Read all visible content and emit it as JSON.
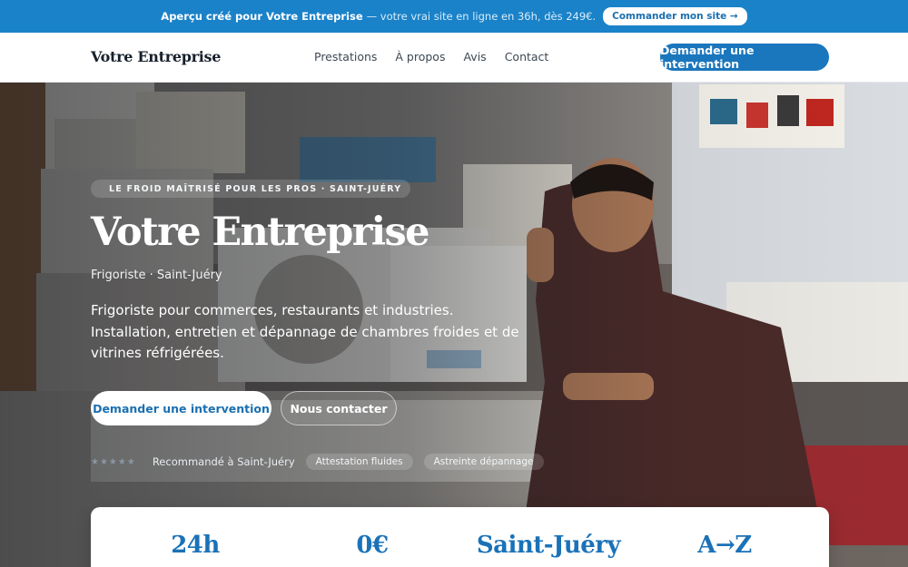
{
  "promo": {
    "lead": "Aperçu créé pour Votre Entreprise",
    "rest": "— votre vrai site en ligne en 36h, dès 249€.",
    "cta": "Commander mon site →"
  },
  "nav": {
    "brand": "Votre Entreprise",
    "items": [
      "Prestations",
      "À propos",
      "Avis",
      "Contact"
    ],
    "cta": "Demander une intervention"
  },
  "hero": {
    "eyebrow": "LE FROID MAÎTRISÉ POUR LES PROS · SAINT-JUÉRY",
    "title": "Votre Entreprise",
    "subtitle": "Frigoriste · Saint-Juéry",
    "description": "Frigoriste pour commerces, restaurants et industries. Installation, entretien et dépannage de chambres froides et de vitrines réfrigérées.",
    "primary_cta": "Demander une intervention",
    "secondary_cta": "Nous contacter",
    "stars": "★★★★★",
    "recommendation": "Recommandé à Saint-Juéry",
    "badges": [
      "Attestation fluides",
      "Astreinte dépannage"
    ],
    "photo_subject": "technician-repairing-air-conditioners"
  },
  "stats": [
    "24h",
    "0€",
    "Saint-Juéry",
    "A→Z"
  ],
  "colors": {
    "accent": "#1a76bd",
    "promo_bar": "#1a82c8",
    "stat_text": "#1a72b8"
  }
}
